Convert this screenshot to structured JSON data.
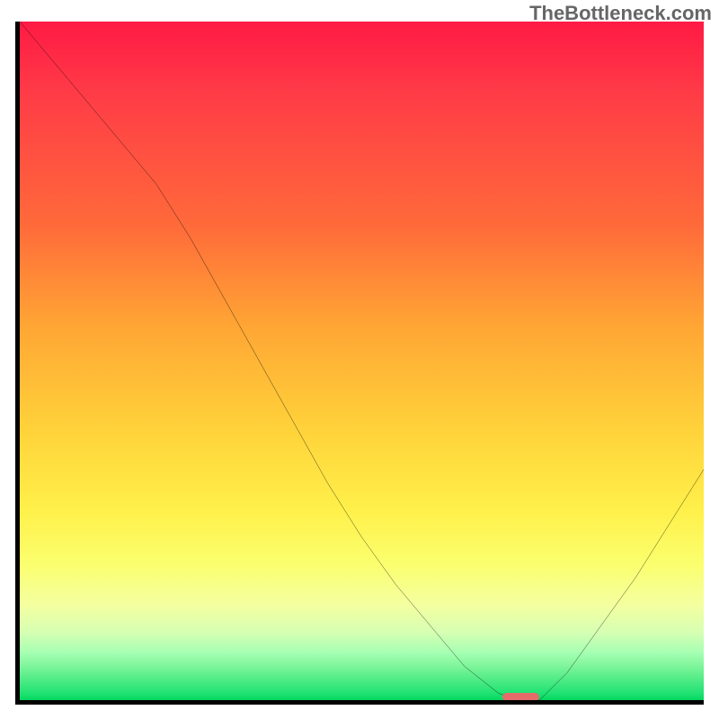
{
  "watermark": "TheBottleneck.com",
  "chart_data": {
    "type": "line",
    "title": "",
    "xlabel": "",
    "ylabel": "",
    "xlim": [
      0,
      100
    ],
    "ylim": [
      0,
      100
    ],
    "grid": false,
    "legend": false,
    "comment": "Bottleneck curve: y ≈ mismatch % (0 at sweet spot). Values estimated from plot pixels; axes are unlabeled in the source image so x is treated as 0–100 horizontal position, y as 0–100 vertical metric. Optimal point (pill marker) at roughly x≈73 where curve touches zero.",
    "series": [
      {
        "name": "bottleneck-curve",
        "x": [
          0,
          5,
          10,
          15,
          20,
          25,
          30,
          35,
          40,
          45,
          50,
          55,
          60,
          65,
          70,
          73,
          76,
          80,
          85,
          90,
          95,
          100
        ],
        "y": [
          100,
          94,
          88,
          82,
          76,
          68,
          59,
          50,
          41,
          32,
          24,
          17,
          11,
          5,
          1,
          0,
          0,
          4,
          11,
          18,
          26,
          34
        ]
      }
    ],
    "marker": {
      "name": "sweet-spot",
      "x_range": [
        70.5,
        76
      ],
      "y": 0,
      "color": "#e56b6b"
    }
  }
}
